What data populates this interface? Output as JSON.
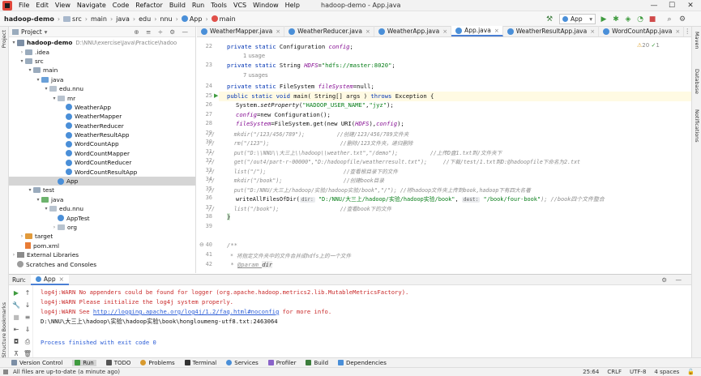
{
  "window": {
    "menus": [
      "File",
      "Edit",
      "View",
      "Navigate",
      "Code",
      "Refactor",
      "Build",
      "Run",
      "Tools",
      "VCS",
      "Window",
      "Help"
    ],
    "title": "hadoop-demo - App.java"
  },
  "breadcrumb": [
    "hadoop-demo",
    "src",
    "main",
    "java",
    "edu",
    "nnu",
    "App",
    "main"
  ],
  "toolbar": {
    "run_config": "App"
  },
  "project": {
    "header": "Project",
    "root_name": "hadoop-demo",
    "root_path": "D:\\NNU\\exercise\\Java\\Practice\\hadoo",
    "items": [
      ".idea",
      "src",
      "main",
      "java",
      "edu.nnu",
      "mr",
      "WeatherApp",
      "WeatherMapper",
      "WeatherReducer",
      "WeatherResultApp",
      "WordCountApp",
      "WordCountMapper",
      "WordCountReducer",
      "WordCountResultApp",
      "App",
      "test",
      "java",
      "edu.nnu",
      "AppTest",
      "org",
      "target",
      "pom.xml",
      "External Libraries",
      "Scratches and Consoles"
    ]
  },
  "tabs": [
    "WeatherMapper.java",
    "WeatherReducer.java",
    "WeatherApp.java",
    "App.java",
    "WeatherResultApp.java",
    "WordCountApp.java"
  ],
  "editor": {
    "warnings": "20",
    "hints": "1",
    "usage1": "1 usage",
    "usage7": "7 usages",
    "lines": [
      "22",
      "",
      "23",
      "",
      "24",
      "25",
      "26",
      "27",
      "28",
      "29",
      "30",
      "31",
      "32",
      "33",
      "34",
      "35",
      "36",
      "37",
      "38",
      "39",
      "40",
      "41",
      "42"
    ],
    "code": {
      "l22": [
        "private static ",
        "Configuration ",
        "config",
        ";"
      ],
      "l23": [
        "private static ",
        "String ",
        "HDFS",
        "=",
        "\"hdfs://master:8020\"",
        ";"
      ],
      "l24": [
        "private static ",
        "FileSystem ",
        "fileSystem",
        "=null;"
      ],
      "l25": [
        "public static void ",
        "main( String[] args ) ",
        "throws ",
        "Exception {"
      ],
      "l26": [
        "System.",
        "setProperty",
        "(",
        "\"HADOOP_USER_NAME\"",
        ",",
        "\"jyz\"",
        ");"
      ],
      "l27": [
        "config",
        "=new Configuration();"
      ],
      "l28": [
        "fileSystem",
        "=FileSystem.get(new URI(",
        "HDFS",
        "),",
        "config",
        ");"
      ],
      "l29": "//      mkdir(\"/123/456/789\");          //创建/123/456/789文件夹",
      "l30": "//      rm(\"/123\");                      //删除/123文件夹，递归删除",
      "l31": "//      put(\"D:\\\\NNU\\\\大三上\\\\hadoop\\\\weather.txt\",\"/demo\");          //上传D盘1.txt到/文件夹下",
      "l32": "//      get(\"/out4/part-r-00000\",\"D:/hadoopfile/weatherresult.txt\");     //下载/test/1.txt到D:@hadoopfile下命名为2.txt",
      "l33": "//      list(\"/\");                        //查看根目录下的文件",
      "l34": "//      mkdir(\"/book\");                   //创建book目录",
      "l35": "//      put(\"D:/NNU/大三上/hadoop/实验/hadoop实验/book\",\"/\"); //将hadoop文件夹上传到book,hadoop下有四大名著",
      "l36": [
        "writeAllFilesOfDir(",
        "dir:",
        "\"D:/NNU/大三上/hadoop/实验/hadoop实验/book\"",
        ", ",
        "dest:",
        "\"/book/four-book\"",
        "); //book四个文件整合"
      ],
      "l37": "//      list(\"/book\");                   //查看book下的文件",
      "l38": "}",
      "l40": "/**",
      "l41": " * 将指定文件夹中的文件合并成hdfs上的一个文件",
      "l42": [
        " * ",
        "@param ",
        "dir"
      ]
    }
  },
  "run": {
    "label": "Run:",
    "tab": "App",
    "output": [
      "log4j:WARN No appenders could be found for logger (org.apache.hadoop.metrics2.lib.MutableMetricsFactory).",
      "log4j:WARN Please initialize the log4j system properly.",
      "log4j:WARN See ",
      "http://logging.apache.org/log4j/1.2/faq.html#noconfig",
      " for more info.",
      "D:\\NNU\\大三上\\hadoop\\实验\\hadoop实验\\book\\hongloumeng-utf8.txt:2463064",
      "Process finished with exit code 0"
    ]
  },
  "side": {
    "left": [
      "Project",
      "Bookmarks",
      "Structure"
    ],
    "right": [
      "Maven",
      "Database",
      "Notifications"
    ]
  },
  "bottom_tabs": [
    "Version Control",
    "Run",
    "TODO",
    "Problems",
    "Terminal",
    "Services",
    "Profiler",
    "Build",
    "Dependencies"
  ],
  "status": {
    "message": "All files are up-to-date (a minute ago)",
    "position": "25:64",
    "line_sep": "CRLF",
    "encoding": "UTF-8",
    "indent": "4 spaces"
  }
}
